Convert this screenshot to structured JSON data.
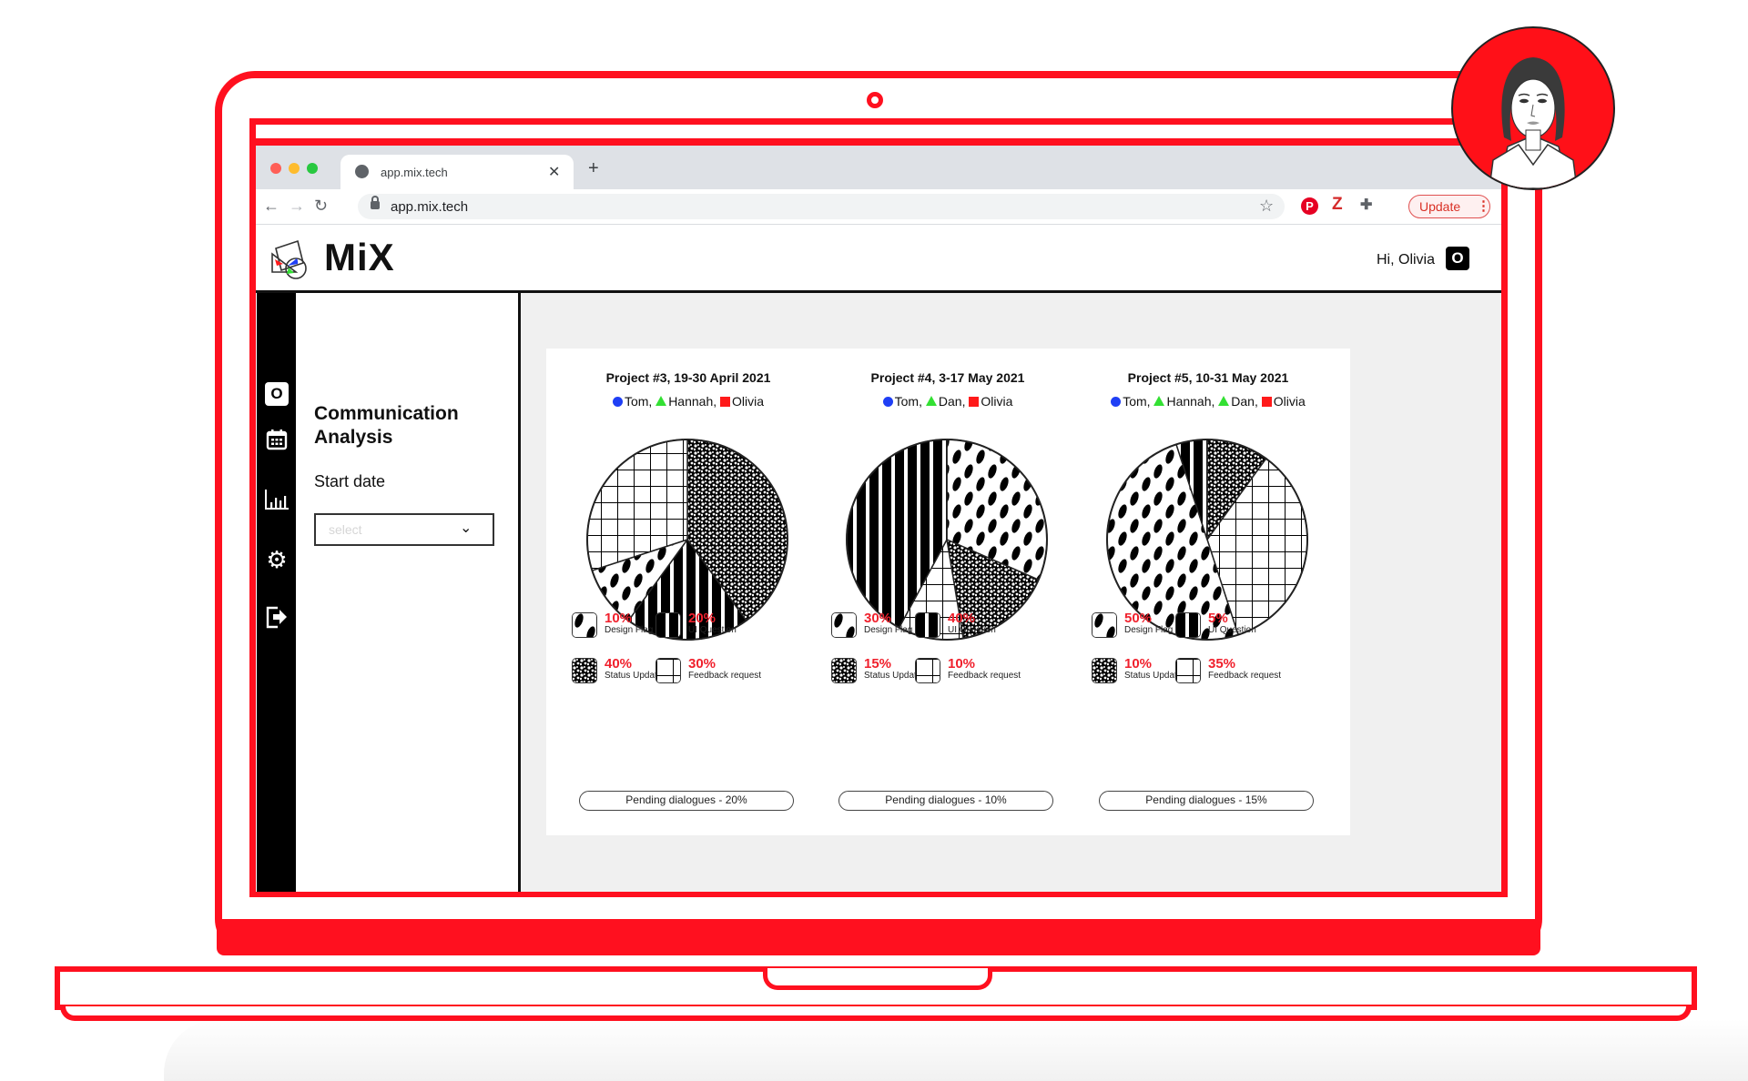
{
  "browser": {
    "tab_title": "app.mix.tech",
    "url": "app.mix.tech",
    "update_label": "Update",
    "extensions": [
      "pinterest-icon",
      "zotero-icon",
      "puzzle-extensions-icon"
    ]
  },
  "app": {
    "logo_text": "MiX",
    "greeting": "Hi, Olivia",
    "user_initial": "O"
  },
  "sidebar": {
    "rail": [
      {
        "icon": "user-badge-icon",
        "label": "O"
      },
      {
        "icon": "calendar-icon"
      },
      {
        "icon": "bar-chart-icon"
      },
      {
        "icon": "gear-icon"
      },
      {
        "icon": "logout-icon"
      }
    ],
    "panel_title": "Communication Analysis",
    "start_date_label": "Start date",
    "select_placeholder": "select"
  },
  "colors": {
    "brand_red": "#ff101f",
    "accent_pct": "#f0202c",
    "person_circle": "#1f3ff5",
    "person_triangle": "#33e033",
    "person_square": "#ff1a1a",
    "content_bg": "#f0f0f0"
  },
  "categories": {
    "design_flag": "Design Flag",
    "ui_question": "UI Question",
    "status_update": "Status Update",
    "feedback_request": "Feedback request"
  },
  "chart_data": [
    {
      "type": "pie",
      "title": "Project #3, 19-30 April 2021",
      "participants": [
        {
          "name": "Tom",
          "marker": "circle"
        },
        {
          "name": "Hannah",
          "marker": "triangle"
        },
        {
          "name": "Olivia",
          "marker": "square"
        }
      ],
      "slices": [
        {
          "key": "status_update",
          "label": "Status Update",
          "value": 40,
          "pct_text": "40%"
        },
        {
          "key": "ui_question",
          "label": "UI Question",
          "value": 20,
          "pct_text": "20%"
        },
        {
          "key": "design_flag",
          "label": "Design Flag",
          "value": 10,
          "pct_text": "10%"
        },
        {
          "key": "feedback_request",
          "label": "Feedback request",
          "value": 30,
          "pct_text": "30%"
        }
      ],
      "pending_text": "Pending dialogues - 20%",
      "pending_value": 20
    },
    {
      "type": "pie",
      "title": "Project #4, 3-17 May 2021",
      "participants": [
        {
          "name": "Tom",
          "marker": "circle"
        },
        {
          "name": "Dan",
          "marker": "triangle"
        },
        {
          "name": "Olivia",
          "marker": "square"
        }
      ],
      "slices": [
        {
          "key": "design_flag",
          "label": "Design Flag",
          "value": 30,
          "pct_text": "30%"
        },
        {
          "key": "status_update",
          "label": "Status Update",
          "value": 15,
          "pct_text": "15%"
        },
        {
          "key": "feedback_request",
          "label": "Feedback request",
          "value": 10,
          "pct_text": "10%"
        },
        {
          "key": "ui_question",
          "label": "UI Question",
          "value": 40,
          "pct_text": "40%"
        }
      ],
      "pending_text": "Pending dialogues - 10%",
      "pending_value": 10
    },
    {
      "type": "pie",
      "title": "Project #5, 10-31 May 2021",
      "participants": [
        {
          "name": "Tom",
          "marker": "circle"
        },
        {
          "name": "Hannah",
          "marker": "triangle"
        },
        {
          "name": "Dan",
          "marker": "triangle"
        },
        {
          "name": "Olivia",
          "marker": "square"
        }
      ],
      "slices": [
        {
          "key": "status_update",
          "label": "Status Update",
          "value": 10,
          "pct_text": "10%"
        },
        {
          "key": "feedback_request",
          "label": "Feedback request",
          "value": 35,
          "pct_text": "35%"
        },
        {
          "key": "design_flag",
          "label": "Design Flag",
          "value": 50,
          "pct_text": "50%"
        },
        {
          "key": "ui_question",
          "label": "UI Question",
          "value": 5,
          "pct_text": "5%"
        }
      ],
      "pending_text": "Pending dialogues - 15%",
      "pending_value": 15
    }
  ]
}
